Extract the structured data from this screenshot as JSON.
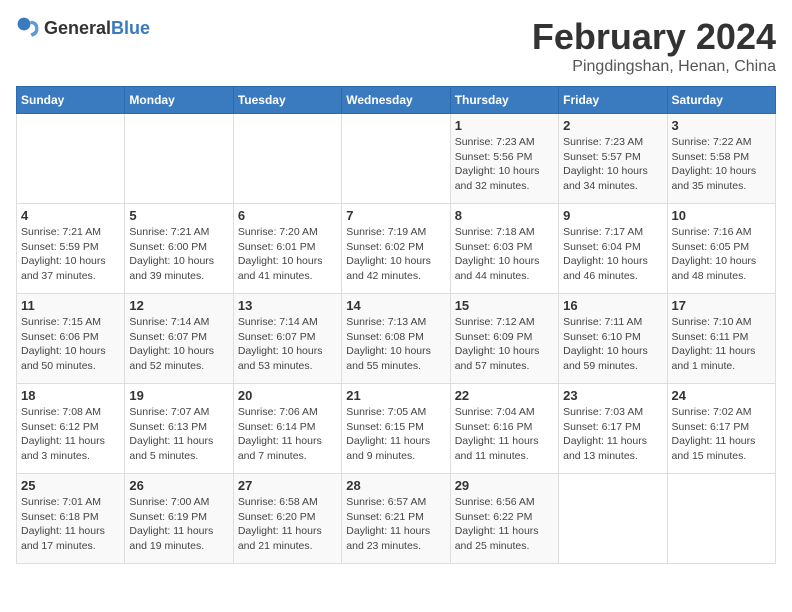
{
  "header": {
    "logo_general": "General",
    "logo_blue": "Blue",
    "title": "February 2024",
    "subtitle": "Pingdingshan, Henan, China"
  },
  "days_of_week": [
    "Sunday",
    "Monday",
    "Tuesday",
    "Wednesday",
    "Thursday",
    "Friday",
    "Saturday"
  ],
  "weeks": [
    [
      {
        "day": "",
        "info": ""
      },
      {
        "day": "",
        "info": ""
      },
      {
        "day": "",
        "info": ""
      },
      {
        "day": "",
        "info": ""
      },
      {
        "day": "1",
        "info": "Sunrise: 7:23 AM\nSunset: 5:56 PM\nDaylight: 10 hours\nand 32 minutes."
      },
      {
        "day": "2",
        "info": "Sunrise: 7:23 AM\nSunset: 5:57 PM\nDaylight: 10 hours\nand 34 minutes."
      },
      {
        "day": "3",
        "info": "Sunrise: 7:22 AM\nSunset: 5:58 PM\nDaylight: 10 hours\nand 35 minutes."
      }
    ],
    [
      {
        "day": "4",
        "info": "Sunrise: 7:21 AM\nSunset: 5:59 PM\nDaylight: 10 hours\nand 37 minutes."
      },
      {
        "day": "5",
        "info": "Sunrise: 7:21 AM\nSunset: 6:00 PM\nDaylight: 10 hours\nand 39 minutes."
      },
      {
        "day": "6",
        "info": "Sunrise: 7:20 AM\nSunset: 6:01 PM\nDaylight: 10 hours\nand 41 minutes."
      },
      {
        "day": "7",
        "info": "Sunrise: 7:19 AM\nSunset: 6:02 PM\nDaylight: 10 hours\nand 42 minutes."
      },
      {
        "day": "8",
        "info": "Sunrise: 7:18 AM\nSunset: 6:03 PM\nDaylight: 10 hours\nand 44 minutes."
      },
      {
        "day": "9",
        "info": "Sunrise: 7:17 AM\nSunset: 6:04 PM\nDaylight: 10 hours\nand 46 minutes."
      },
      {
        "day": "10",
        "info": "Sunrise: 7:16 AM\nSunset: 6:05 PM\nDaylight: 10 hours\nand 48 minutes."
      }
    ],
    [
      {
        "day": "11",
        "info": "Sunrise: 7:15 AM\nSunset: 6:06 PM\nDaylight: 10 hours\nand 50 minutes."
      },
      {
        "day": "12",
        "info": "Sunrise: 7:14 AM\nSunset: 6:07 PM\nDaylight: 10 hours\nand 52 minutes."
      },
      {
        "day": "13",
        "info": "Sunrise: 7:14 AM\nSunset: 6:07 PM\nDaylight: 10 hours\nand 53 minutes."
      },
      {
        "day": "14",
        "info": "Sunrise: 7:13 AM\nSunset: 6:08 PM\nDaylight: 10 hours\nand 55 minutes."
      },
      {
        "day": "15",
        "info": "Sunrise: 7:12 AM\nSunset: 6:09 PM\nDaylight: 10 hours\nand 57 minutes."
      },
      {
        "day": "16",
        "info": "Sunrise: 7:11 AM\nSunset: 6:10 PM\nDaylight: 10 hours\nand 59 minutes."
      },
      {
        "day": "17",
        "info": "Sunrise: 7:10 AM\nSunset: 6:11 PM\nDaylight: 11 hours\nand 1 minute."
      }
    ],
    [
      {
        "day": "18",
        "info": "Sunrise: 7:08 AM\nSunset: 6:12 PM\nDaylight: 11 hours\nand 3 minutes."
      },
      {
        "day": "19",
        "info": "Sunrise: 7:07 AM\nSunset: 6:13 PM\nDaylight: 11 hours\nand 5 minutes."
      },
      {
        "day": "20",
        "info": "Sunrise: 7:06 AM\nSunset: 6:14 PM\nDaylight: 11 hours\nand 7 minutes."
      },
      {
        "day": "21",
        "info": "Sunrise: 7:05 AM\nSunset: 6:15 PM\nDaylight: 11 hours\nand 9 minutes."
      },
      {
        "day": "22",
        "info": "Sunrise: 7:04 AM\nSunset: 6:16 PM\nDaylight: 11 hours\nand 11 minutes."
      },
      {
        "day": "23",
        "info": "Sunrise: 7:03 AM\nSunset: 6:17 PM\nDaylight: 11 hours\nand 13 minutes."
      },
      {
        "day": "24",
        "info": "Sunrise: 7:02 AM\nSunset: 6:17 PM\nDaylight: 11 hours\nand 15 minutes."
      }
    ],
    [
      {
        "day": "25",
        "info": "Sunrise: 7:01 AM\nSunset: 6:18 PM\nDaylight: 11 hours\nand 17 minutes."
      },
      {
        "day": "26",
        "info": "Sunrise: 7:00 AM\nSunset: 6:19 PM\nDaylight: 11 hours\nand 19 minutes."
      },
      {
        "day": "27",
        "info": "Sunrise: 6:58 AM\nSunset: 6:20 PM\nDaylight: 11 hours\nand 21 minutes."
      },
      {
        "day": "28",
        "info": "Sunrise: 6:57 AM\nSunset: 6:21 PM\nDaylight: 11 hours\nand 23 minutes."
      },
      {
        "day": "29",
        "info": "Sunrise: 6:56 AM\nSunset: 6:22 PM\nDaylight: 11 hours\nand 25 minutes."
      },
      {
        "day": "",
        "info": ""
      },
      {
        "day": "",
        "info": ""
      }
    ]
  ]
}
